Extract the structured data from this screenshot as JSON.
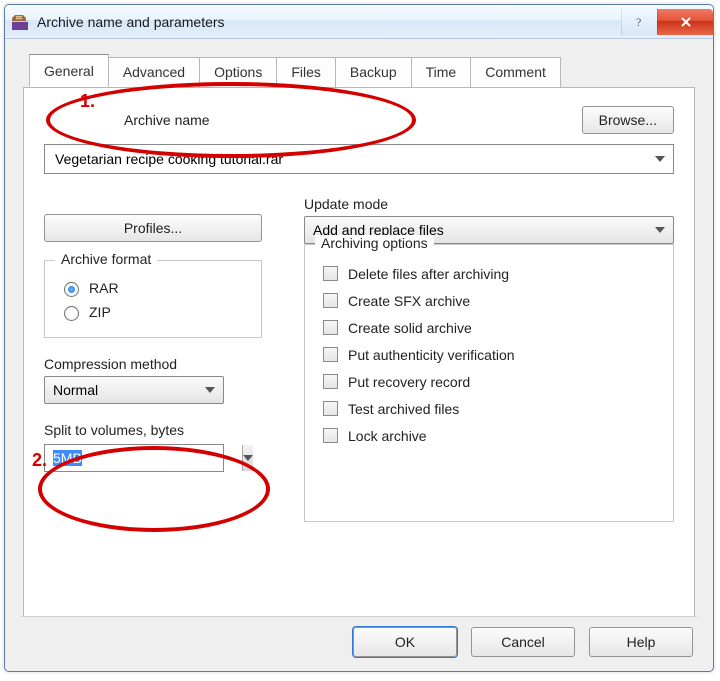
{
  "window": {
    "title": "Archive name and parameters"
  },
  "tabs": {
    "general": "General",
    "advanced": "Advanced",
    "options": "Options",
    "files": "Files",
    "backup": "Backup",
    "time": "Time",
    "comment": "Comment"
  },
  "archive_name": {
    "label": "Archive name",
    "value": "Vegetarian recipe cooking tutorial.rar",
    "browse": "Browse..."
  },
  "profiles_button": "Profiles...",
  "update_mode": {
    "label": "Update mode",
    "selected": "Add and replace files"
  },
  "archive_format": {
    "legend": "Archive format",
    "rar": "RAR",
    "zip": "ZIP",
    "selected": "RAR"
  },
  "compression_method": {
    "label": "Compression method",
    "selected": "Normal"
  },
  "split_volumes": {
    "label": "Split to volumes, bytes",
    "value": "5MB"
  },
  "archiving_options": {
    "legend": "Archiving options",
    "items": [
      "Delete files after archiving",
      "Create SFX archive",
      "Create solid archive",
      "Put authenticity verification",
      "Put recovery record",
      "Test archived files",
      "Lock archive"
    ]
  },
  "buttons": {
    "ok": "OK",
    "cancel": "Cancel",
    "help": "Help"
  },
  "annotations": {
    "num1": "1.",
    "num2": "2."
  }
}
